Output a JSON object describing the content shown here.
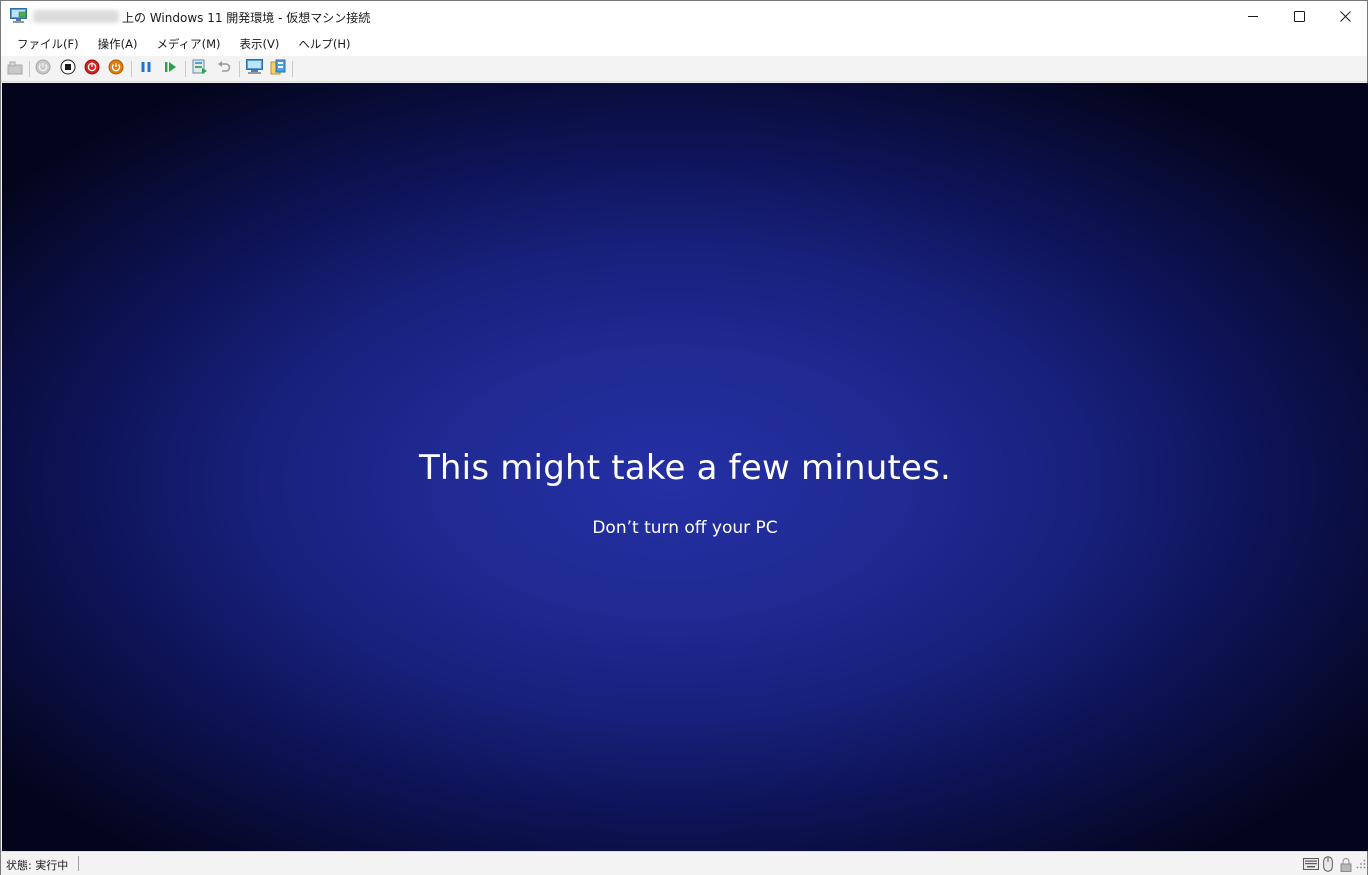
{
  "window": {
    "title_blurred": "",
    "title": "上の Windows 11 開発環境 - 仮想マシン接続",
    "controls": [
      "minimize-icon",
      "maximize-icon",
      "close-icon"
    ]
  },
  "menu": {
    "items": [
      {
        "label": "ファイル(F)"
      },
      {
        "label": "操作(A)"
      },
      {
        "label": "メディア(M)"
      },
      {
        "label": "表示(V)"
      },
      {
        "label": "ヘルプ(H)"
      }
    ]
  },
  "toolbar": {
    "buttons": [
      "ctrl-alt-del-icon",
      "start-icon",
      "turn-off-icon",
      "shutdown-icon",
      "save-icon",
      "pause-icon",
      "resume-icon",
      "checkpoint-icon",
      "revert-icon",
      "enhanced-session-icon",
      "share-icon"
    ],
    "colors": {
      "shutdown": "#d32020",
      "save": "#e07c0c",
      "pause": "#1e73d2",
      "resume": "#22a447"
    }
  },
  "vm": {
    "headline": "This might take a few minutes.",
    "subline": "Don’t turn off your PC",
    "background_color": "#1f2a92"
  },
  "status": {
    "text": "状態: 実行中",
    "icons": [
      "keyboard-icon",
      "mouse-icon",
      "lock-icon"
    ]
  }
}
